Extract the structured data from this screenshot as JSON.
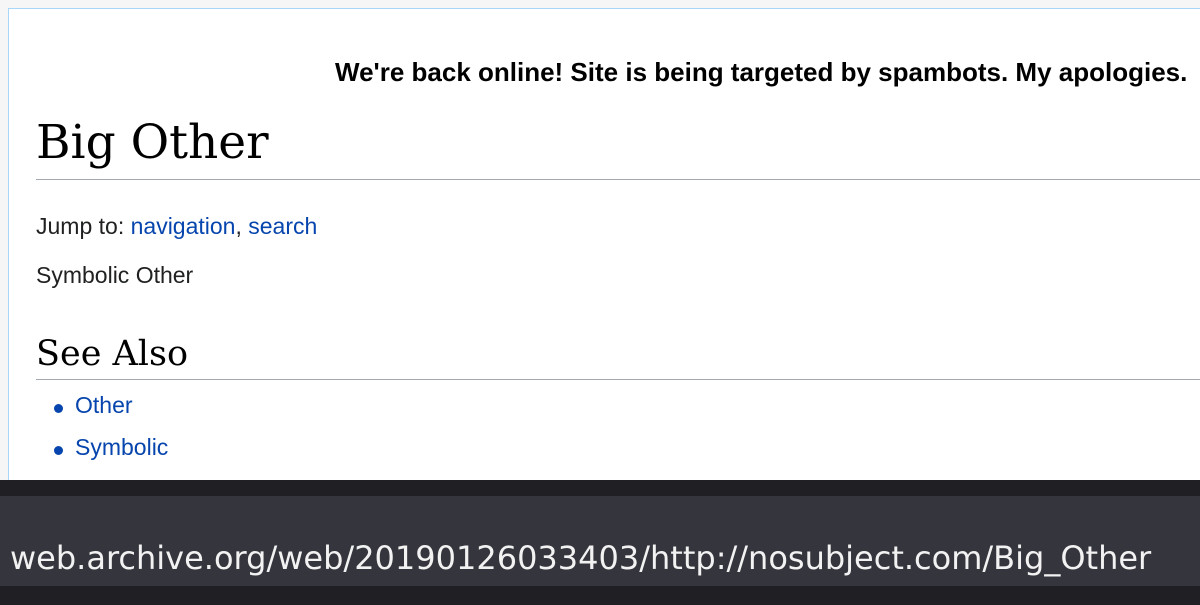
{
  "site_notice": "We're back online! Site is being targeted by spambots. My apologies.",
  "page": {
    "title": "Big Other",
    "jump_prefix": "Jump to:",
    "jump_navigation": "navigation",
    "jump_separator": ",",
    "jump_search": "search",
    "paragraph": "Symbolic Other",
    "section_heading": "See Also",
    "see_also": [
      {
        "label": "Other"
      },
      {
        "label": "Symbolic"
      }
    ]
  },
  "status_bar": {
    "url": "web.archive.org/web/20190126033403/http://nosubject.com/Big_Other"
  },
  "colors": {
    "link": "#0645ad",
    "heading_rule": "#a2a9b1",
    "url_bar_bg": "#35353d"
  }
}
